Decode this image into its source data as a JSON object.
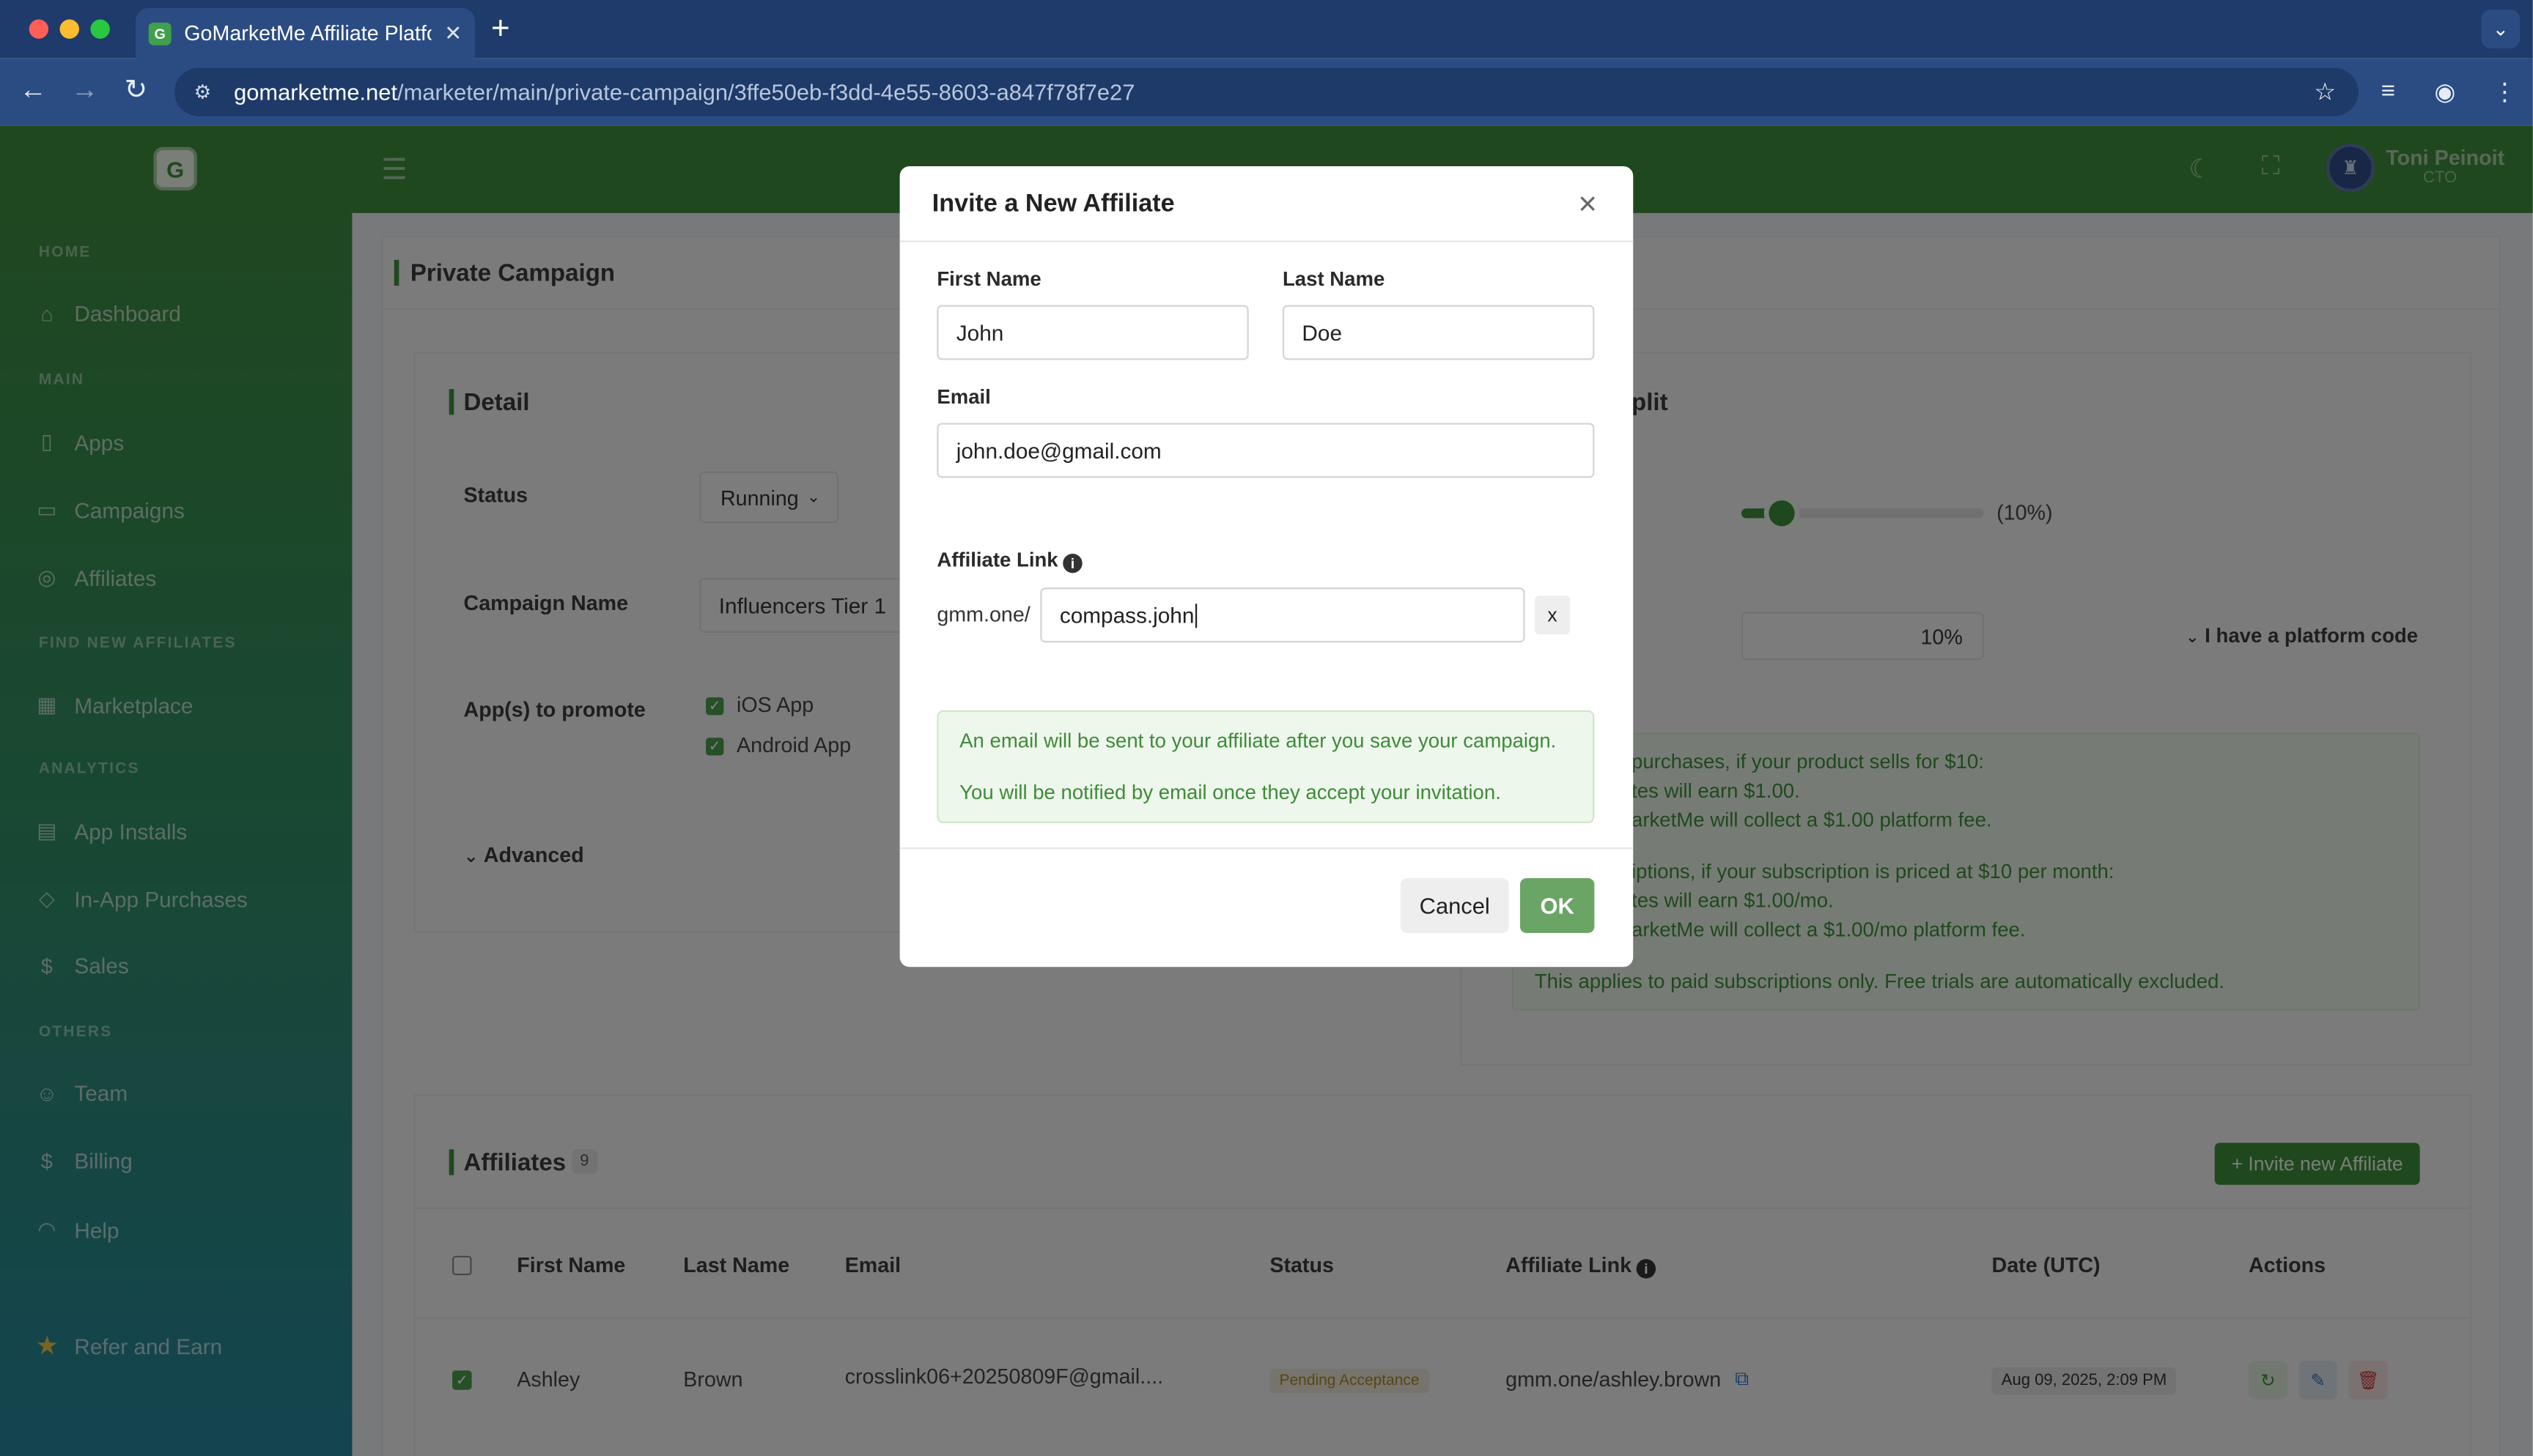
{
  "browser": {
    "tab_title": "GoMarketMe Affiliate Platform",
    "url_domain": "gomarketme.net",
    "url_path": "/marketer/main/private-campaign/3ffe50eb-f3dd-4e55-8603-a847f78f7e27"
  },
  "sidebar": {
    "logo_letter": "G",
    "sections": {
      "home": "HOME",
      "main": "MAIN",
      "find": "FIND NEW AFFILIATES",
      "analytics": "ANALYTICS",
      "others": "OTHERS"
    },
    "items": {
      "dashboard": "Dashboard",
      "apps": "Apps",
      "campaigns": "Campaigns",
      "affiliates": "Affiliates",
      "marketplace": "Marketplace",
      "app_installs": "App Installs",
      "in_app_purchases": "In-App Purchases",
      "sales": "Sales",
      "team": "Team",
      "billing": "Billing",
      "help": "Help",
      "refer": "Refer and Earn"
    }
  },
  "header": {
    "user_name": "Toni Peinoit",
    "user_role": "CTO"
  },
  "page": {
    "title": "Private Campaign",
    "detail": {
      "heading": "Detail",
      "status_label": "Status",
      "status_value": "Running",
      "campaign_name_label": "Campaign Name",
      "campaign_name_value": "Influencers Tier 1",
      "apps_label": "App(s) to promote",
      "app_ios": "iOS App",
      "app_android": "Android App",
      "advanced": "Advanced"
    },
    "split": {
      "heading_partial": "plit",
      "slider_text": "(10%)",
      "slider_fraction": 0.1,
      "fee_value": "10%",
      "platform_code": "I have a platform code",
      "info_lines": [
        "purchases, if your product sells for $10:",
        "tes will earn $1.00.",
        "arketMe will collect a $1.00 platform fee.",
        "iptions, if your subscription is priced at $10 per month:",
        "tes will earn $1.00/mo.",
        "arketMe will collect a $1.00/mo platform fee.",
        "This applies to paid subscriptions only. Free trials are automatically excluded."
      ]
    },
    "affiliates": {
      "heading": "Affiliates",
      "count": "9",
      "invite_button": "+ Invite new Affiliate",
      "columns": [
        "First Name",
        "Last Name",
        "Email",
        "Status",
        "Affiliate Link",
        "Date (UTC)",
        "Actions"
      ],
      "rows": [
        {
          "first": "Ashley",
          "last": "Brown",
          "email": "crosslink06+20250809F@gmail....",
          "status": "Pending Acceptance",
          "link": "gmm.one/ashley.brown",
          "date": "Aug 09, 2025, 2:09 PM"
        }
      ]
    }
  },
  "modal": {
    "title": "Invite a New Affiliate",
    "first_name_label": "First Name",
    "first_name_value": "John",
    "last_name_label": "Last Name",
    "last_name_value": "Doe",
    "email_label": "Email",
    "email_value": "john.doe@gmail.com",
    "link_label": "Affiliate Link",
    "link_prefix": "gmm.one/",
    "link_value": "compass.john",
    "clear_label": "x",
    "alert_line1": "An email will be sent to your affiliate after you save your campaign.",
    "alert_line2": "You will be notified by email once they accept your invitation.",
    "cancel_label": "Cancel",
    "ok_label": "OK"
  },
  "colors": {
    "brand_green": "#3f8a3a",
    "browser_blue": "#2b4c83"
  }
}
